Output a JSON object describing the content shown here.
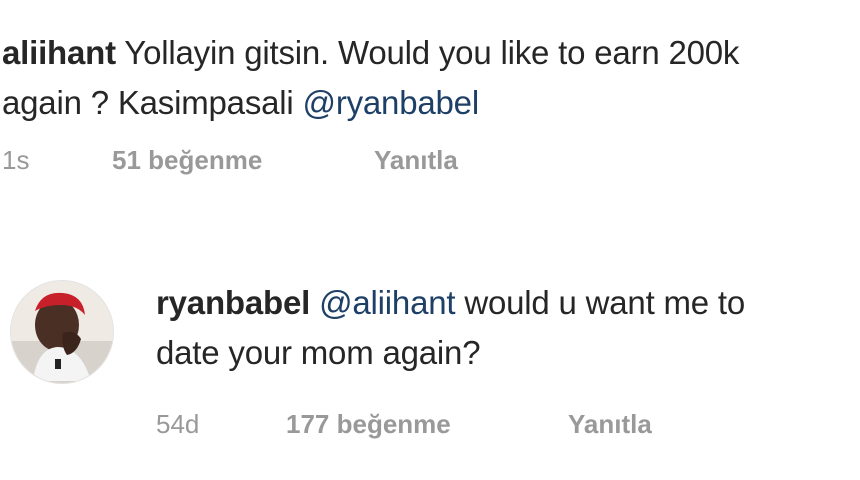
{
  "comments": [
    {
      "username": "aliihant",
      "text_before_mention": "Yollayin gitsin. Would you like to earn 200k",
      "line2_text": "again ? Kasimpasali ",
      "mention": "@ryanbabel",
      "time": "1s",
      "likes": "51 beğenme",
      "reply_label": "Yanıtla"
    },
    {
      "username": "ryanbabel",
      "mention": "@aliihant",
      "text_after_mention": " would u want me to",
      "line2_text": "date your mom again?",
      "time": "54d",
      "likes": "177 beğenme",
      "reply_label": "Yanıtla",
      "avatar_icon": "profile-photo"
    }
  ],
  "colors": {
    "text": "#262626",
    "mention": "#1e3f66",
    "meta": "#999999",
    "background": "#ffffff"
  }
}
